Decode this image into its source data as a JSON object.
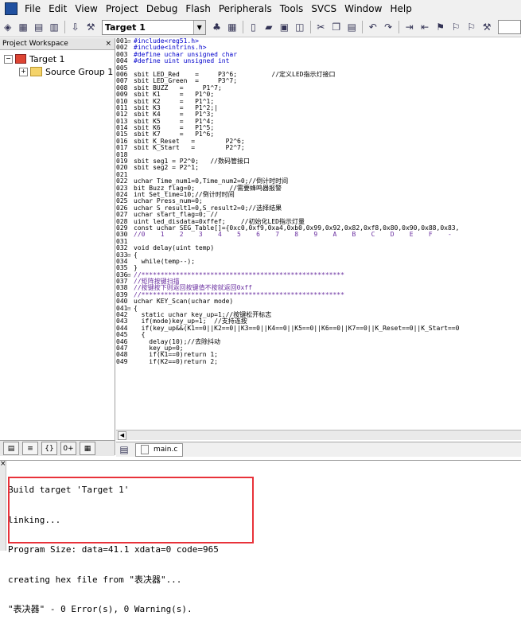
{
  "menu": [
    "File",
    "Edit",
    "View",
    "Project",
    "Debug",
    "Flash",
    "Peripherals",
    "Tools",
    "SVCS",
    "Window",
    "Help"
  ],
  "toolbar": {
    "target_select": "Target 1"
  },
  "workspace": {
    "title": "Project Workspace",
    "close": "×",
    "tree": [
      {
        "label": "Target 1",
        "toggle": "−",
        "level": 0
      },
      {
        "label": "Source Group 1",
        "toggle": "+",
        "level": 1
      }
    ]
  },
  "editor": {
    "lines": [
      {
        "n": "001",
        "f": "⊟",
        "t": "#include<reg51.h>",
        "c": "blue"
      },
      {
        "n": "002",
        "f": "",
        "t": "#include<intrins.h>",
        "c": "blue"
      },
      {
        "n": "003",
        "f": "",
        "t": "#define uchar unsigned char",
        "c": "blue"
      },
      {
        "n": "004",
        "f": "",
        "t": "#define uint unsigned int",
        "c": "blue"
      },
      {
        "n": "005",
        "f": "",
        "t": "",
        "c": ""
      },
      {
        "n": "006",
        "f": "",
        "t": "sbit LED_Red    =     P3^6;         //定义LED指示灯接口",
        "c": ""
      },
      {
        "n": "007",
        "f": "",
        "t": "sbit LED_Green  =     P3^7;",
        "c": ""
      },
      {
        "n": "008",
        "f": "",
        "t": "sbit BUZZ   =     P1^7;",
        "c": ""
      },
      {
        "n": "009",
        "f": "",
        "t": "sbit K1     =   P1^0;",
        "c": ""
      },
      {
        "n": "010",
        "f": "",
        "t": "sbit K2     =   P1^1;",
        "c": ""
      },
      {
        "n": "011",
        "f": "",
        "t": "sbit K3     =   P1^2;|",
        "c": ""
      },
      {
        "n": "012",
        "f": "",
        "t": "sbit K4     =   P1^3;",
        "c": ""
      },
      {
        "n": "013",
        "f": "",
        "t": "sbit K5     =   P1^4;",
        "c": ""
      },
      {
        "n": "014",
        "f": "",
        "t": "sbit K6     =   P1^5;",
        "c": ""
      },
      {
        "n": "015",
        "f": "",
        "t": "sbit K7     =   P1^6;",
        "c": ""
      },
      {
        "n": "016",
        "f": "",
        "t": "sbit K_Reset   =        P2^6;",
        "c": ""
      },
      {
        "n": "017",
        "f": "",
        "t": "sbit K_Start   =        P2^7;",
        "c": ""
      },
      {
        "n": "018",
        "f": "",
        "t": "",
        "c": ""
      },
      {
        "n": "019",
        "f": "",
        "t": "sbit seg1 = P2^0;   //数码管接口",
        "c": ""
      },
      {
        "n": "020",
        "f": "",
        "t": "sbit seg2 = P2^1;",
        "c": ""
      },
      {
        "n": "021",
        "f": "",
        "t": "",
        "c": ""
      },
      {
        "n": "022",
        "f": "",
        "t": "uchar Time_num1=0,Time_num2=0;//倒计时时间",
        "c": ""
      },
      {
        "n": "023",
        "f": "",
        "t": "bit Buzz_flag=0;         //需要蜂鸣器报警",
        "c": ""
      },
      {
        "n": "024",
        "f": "",
        "t": "int Set_time=10;//倒计时时间",
        "c": ""
      },
      {
        "n": "025",
        "f": "",
        "t": "uchar Press_num=0;",
        "c": ""
      },
      {
        "n": "026",
        "f": "",
        "t": "uchar S_result1=0,S_result2=0;//选择结果",
        "c": ""
      },
      {
        "n": "027",
        "f": "",
        "t": "uchar start_flag=0; //",
        "c": ""
      },
      {
        "n": "028",
        "f": "",
        "t": "uint led_disdata=0xffef;    //初始化LED指示灯量",
        "c": ""
      },
      {
        "n": "029",
        "f": "",
        "t": "const uchar SEG_Table[]={0xc0,0xf9,0xa4,0xb0,0x99,0x92,0x82,0xf8,0x80,0x90,0x88,0x83,",
        "c": ""
      },
      {
        "n": "030",
        "f": "",
        "t": "//0    1    2    3    4    5    6    7    8    9    A    B    C    D    E    F    -",
        "c": "comment"
      },
      {
        "n": "031",
        "f": "",
        "t": "",
        "c": ""
      },
      {
        "n": "032",
        "f": "",
        "t": "void delay(uint temp)",
        "c": ""
      },
      {
        "n": "033",
        "f": "⊟",
        "t": "{",
        "c": ""
      },
      {
        "n": "034",
        "f": "",
        "t": "  while(temp--);",
        "c": ""
      },
      {
        "n": "035",
        "f": "",
        "t": "}",
        "c": ""
      },
      {
        "n": "036",
        "f": "⊟",
        "t": "//*****************************************************",
        "c": "comment"
      },
      {
        "n": "037",
        "f": "",
        "t": "//矩阵按键扫描",
        "c": "comment"
      },
      {
        "n": "038",
        "f": "",
        "t": "//按键按下则返回按键值不按就返回0xff",
        "c": "comment"
      },
      {
        "n": "039",
        "f": "",
        "t": "//*****************************************************",
        "c": "comment"
      },
      {
        "n": "040",
        "f": "",
        "t": "uchar KEY_Scan(uchar mode)",
        "c": ""
      },
      {
        "n": "041",
        "f": "⊟",
        "t": "{",
        "c": ""
      },
      {
        "n": "042",
        "f": "",
        "t": "  static uchar key_up=1;//按键松开标志",
        "c": ""
      },
      {
        "n": "043",
        "f": "",
        "t": "  if(mode)key_up=1;  //支持连按",
        "c": ""
      },
      {
        "n": "044",
        "f": "",
        "t": "  if(key_up&&(K1==0||K2==0||K3==0||K4==0||K5==0||K6==0||K7==0||K_Reset==0||K_Start==0",
        "c": ""
      },
      {
        "n": "045",
        "f": "",
        "t": "  {",
        "c": ""
      },
      {
        "n": "046",
        "f": "",
        "t": "    delay(10);//去除抖动",
        "c": ""
      },
      {
        "n": "047",
        "f": "",
        "t": "    key_up=0;",
        "c": ""
      },
      {
        "n": "048",
        "f": "",
        "t": "    if(K1==0)return 1;",
        "c": ""
      },
      {
        "n": "049",
        "f": "",
        "t": "    if(K2==0)return 2;",
        "c": ""
      }
    ]
  },
  "file_tab": "main.c",
  "output": {
    "lines": [
      "Build target 'Target 1'",
      "linking...",
      "Program Size: data=41.1 xdata=0 code=965",
      "creating hex file from \"表决器\"...",
      "\"表决器\" - 0 Error(s), 0 Warning(s)."
    ],
    "close": "×"
  },
  "colors": {
    "highlight_box": "#e8323a",
    "keyword": "#0000cc",
    "comment": "#6a2fa0"
  }
}
